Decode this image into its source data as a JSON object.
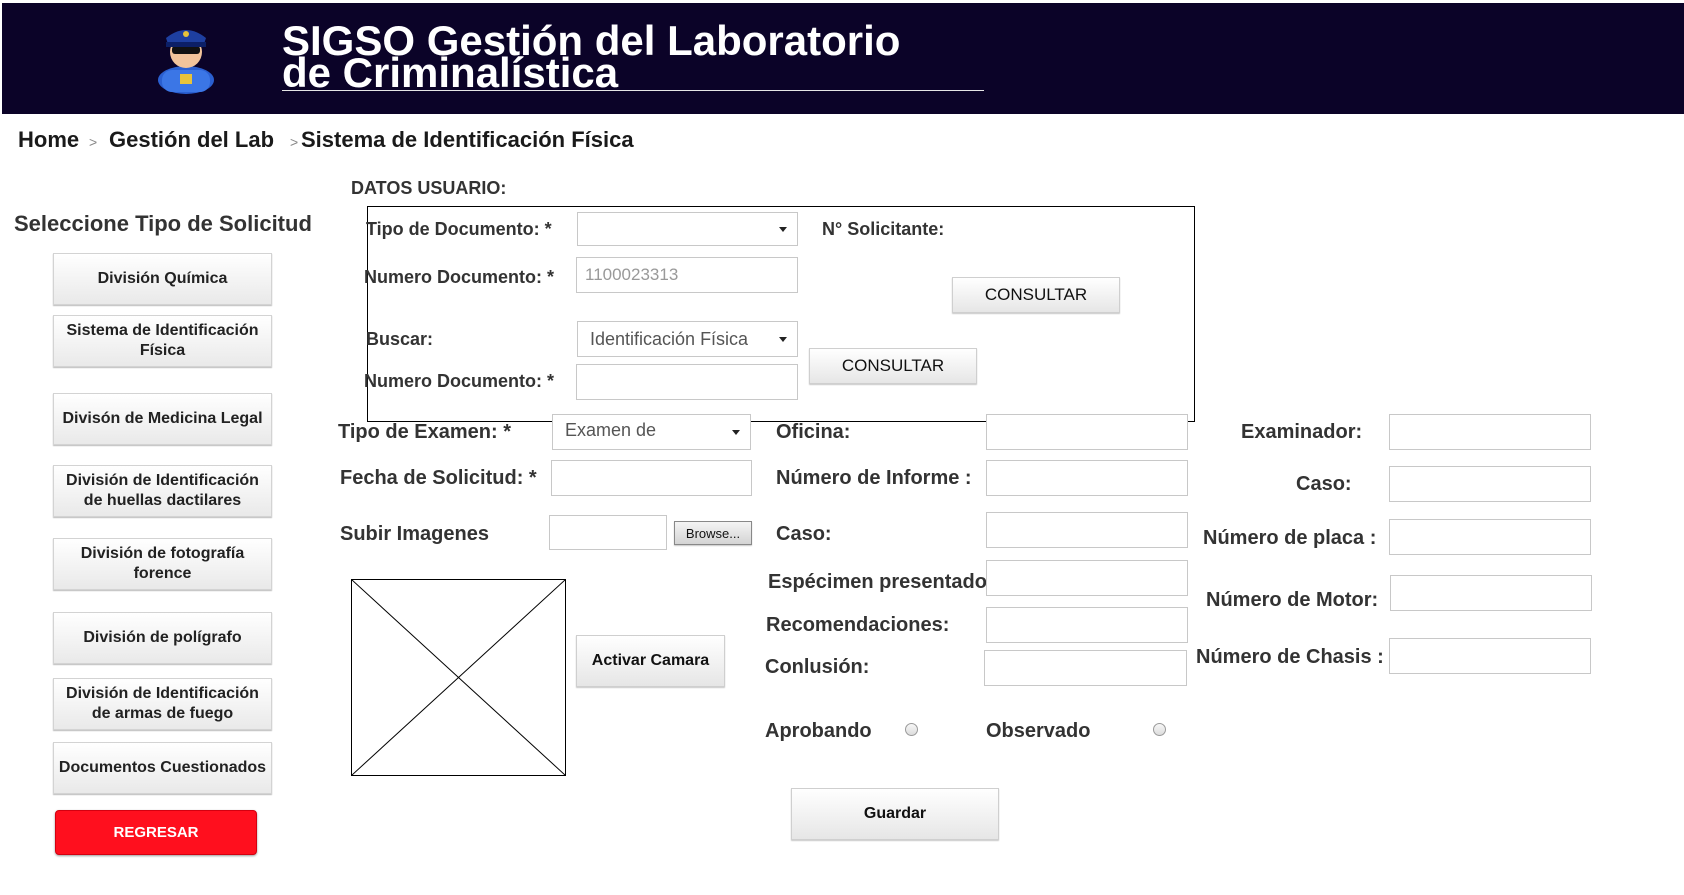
{
  "header": {
    "title_line1": "SIGSO  Gestión del Laboratorio",
    "title_line2": "de Criminalística",
    "logo_icon": "police-officer-icon",
    "bg_color": "#0b0328"
  },
  "breadcrumb": {
    "items": [
      "Home",
      "Gestión del Lab",
      "Sistema de Identificación Física"
    ],
    "separator": ">"
  },
  "sidebar": {
    "title": "Seleccione Tipo de Solicitud",
    "items": [
      {
        "label": "División Química"
      },
      {
        "label": "Sistema de Identificación Física"
      },
      {
        "label": "Divisón de Medicina Legal"
      },
      {
        "label": "División de Identificación de huellas dactilares"
      },
      {
        "label": "División de fotografía forence"
      },
      {
        "label": "División de polígrafo"
      },
      {
        "label": "División de Identificación de armas de fuego"
      },
      {
        "label": "Documentos Cuestionados"
      }
    ],
    "back_button": "REGRESAR",
    "back_color": "#ff0f1e"
  },
  "user_data": {
    "section_title": "DATOS USUARIO:",
    "tipo_documento_label": "Tipo de Documento: *",
    "tipo_documento_value": "",
    "solicitante_label": "N° Solicitante:",
    "numero_documento_label": "Numero Documento: *",
    "numero_documento_placeholder": "1100023313",
    "consultar1": "CONSULTAR",
    "buscar_label": "Buscar:",
    "buscar_value": "Identificación Física",
    "consultar2": "CONSULTAR",
    "numero_documento2_label": "Numero Documento: *",
    "numero_documento2_value": ""
  },
  "form": {
    "tipo_examen_label": "Tipo de Examen: *",
    "tipo_examen_value": "Examen de",
    "fecha_label": "Fecha de Solicitud: *",
    "subir_label": "Subir Imagenes",
    "browse_label": "Browse...",
    "activar_camara": "Activar Camara",
    "oficina_label": "Oficina:",
    "numero_informe_label": "Número de Informe :",
    "caso_label": "Caso:",
    "especimen_label": "Espécimen presentado:",
    "recomendaciones_label": "Recomendaciones:",
    "conclusion_label": "Conlusión:",
    "examinador_label": "Examinador:",
    "caso2_label": "Caso:",
    "placa_label": "Número de placa :",
    "motor_label": "Número de Motor:",
    "chasis_label": "Número de Chasis :",
    "aprobando_label": "Aprobando",
    "observado_label": "Observado",
    "guardar": "Guardar"
  }
}
